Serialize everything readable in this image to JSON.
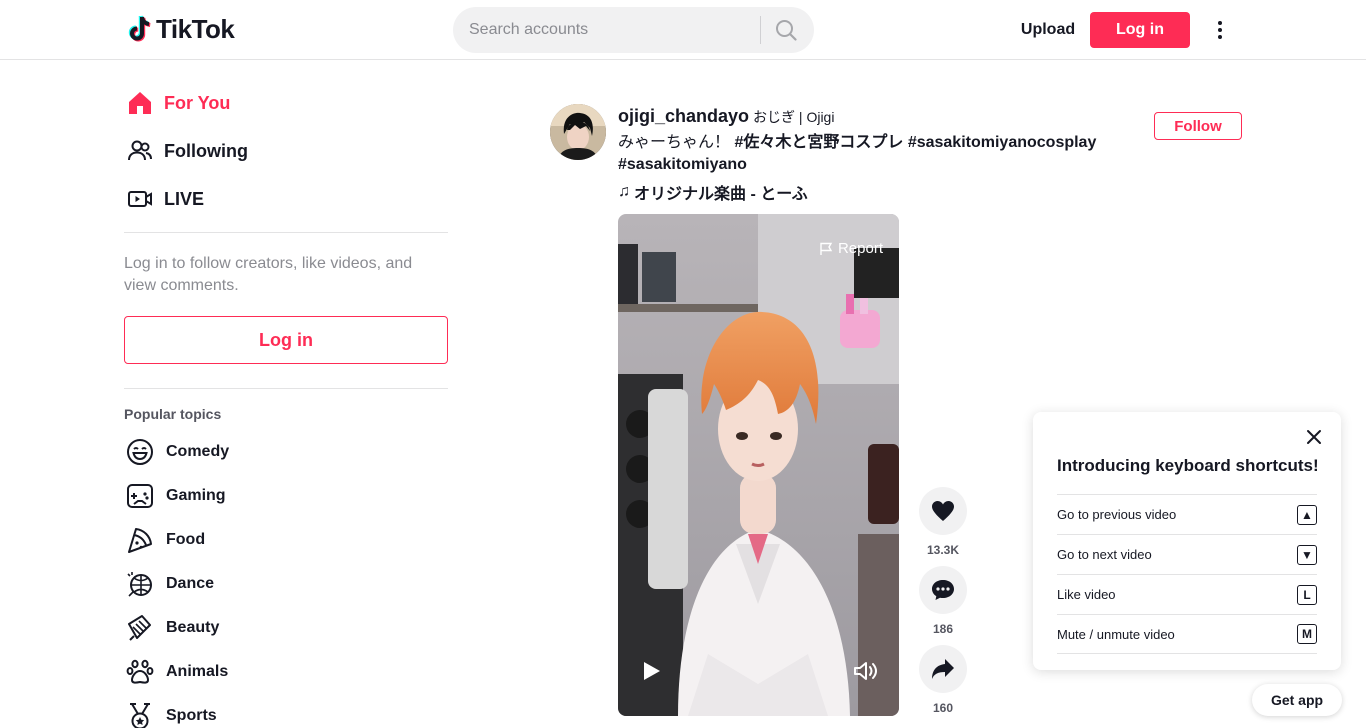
{
  "header": {
    "logo_text": "TikTok",
    "search_placeholder": "Search accounts",
    "upload_label": "Upload",
    "login_label": "Log in"
  },
  "sidebar": {
    "nav": [
      {
        "label": "For You",
        "icon": "home-icon",
        "active": true
      },
      {
        "label": "Following",
        "icon": "following-icon",
        "active": false
      },
      {
        "label": "LIVE",
        "icon": "live-icon",
        "active": false
      }
    ],
    "login_prompt": "Log in to follow creators, like videos, and view comments.",
    "login_label": "Log in",
    "topics_title": "Popular topics",
    "topics": [
      {
        "label": "Comedy",
        "icon": "comedy-icon"
      },
      {
        "label": "Gaming",
        "icon": "gaming-icon"
      },
      {
        "label": "Food",
        "icon": "food-icon"
      },
      {
        "label": "Dance",
        "icon": "dance-icon"
      },
      {
        "label": "Beauty",
        "icon": "beauty-icon"
      },
      {
        "label": "Animals",
        "icon": "animals-icon"
      },
      {
        "label": "Sports",
        "icon": "sports-icon"
      }
    ]
  },
  "post": {
    "username": "ojigi_chandayo",
    "nickname": "おじぎ | Ojigi",
    "caption_text": "みゃーちゃん！ ",
    "hashtags": [
      "#佐々木と宮野コスプレ",
      "#sasakitomiyanocosplay",
      "#sasakitomiyano"
    ],
    "music": "オリジナル楽曲 - とーふ",
    "follow_label": "Follow",
    "report_label": "Report",
    "likes": "13.3K",
    "comments": "186",
    "shares": "160"
  },
  "shortcuts": {
    "title": "Introducing keyboard shortcuts!",
    "items": [
      {
        "label": "Go to previous video",
        "key": "▲"
      },
      {
        "label": "Go to next video",
        "key": "▼"
      },
      {
        "label": "Like video",
        "key": "L"
      },
      {
        "label": "Mute / unmute video",
        "key": "M"
      }
    ]
  },
  "get_app_label": "Get app",
  "colors": {
    "accent": "#fe2c55",
    "text": "#161823",
    "muted": "#8a8b91"
  }
}
